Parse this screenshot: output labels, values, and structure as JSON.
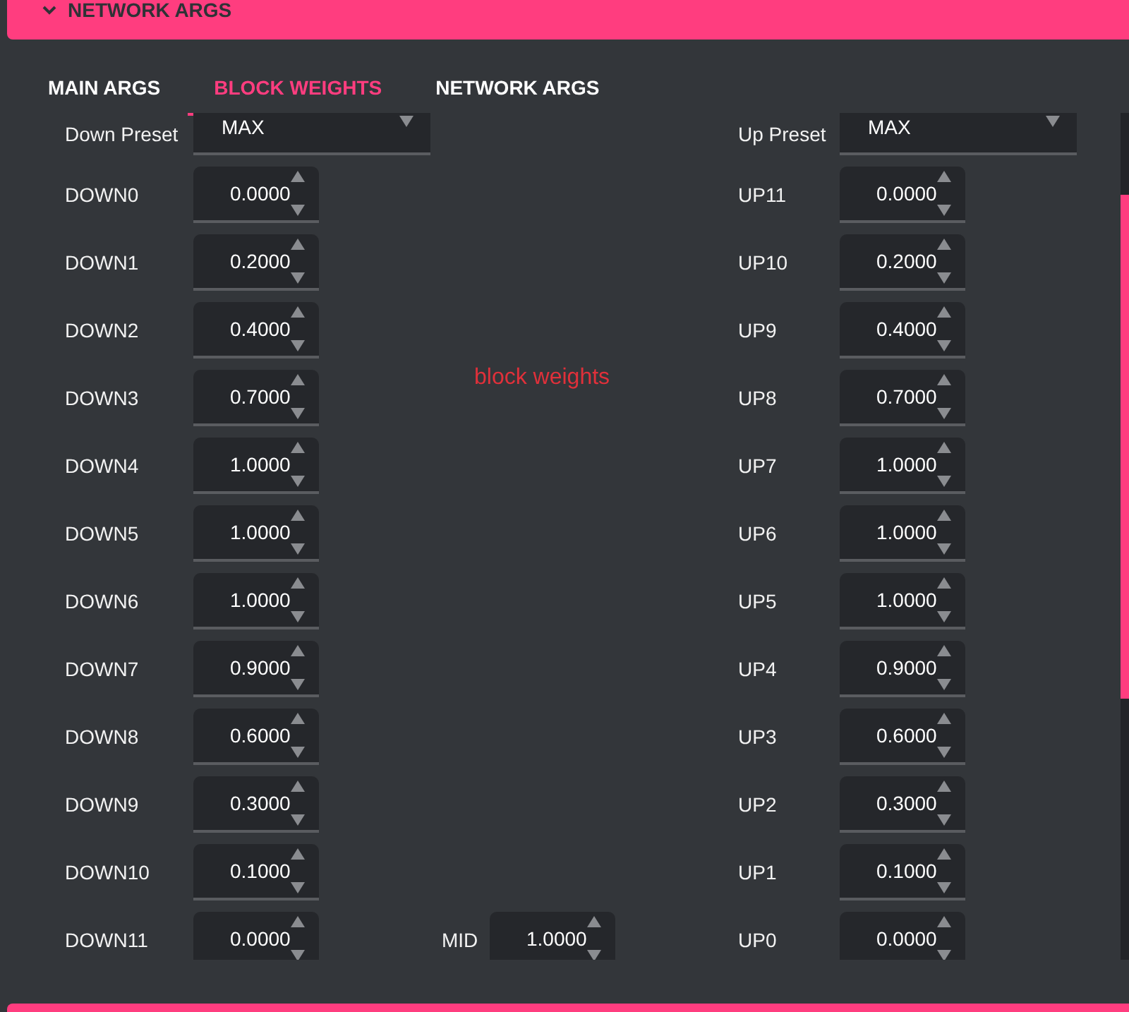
{
  "section": {
    "title": "NETWORK ARGS",
    "expanded": true
  },
  "tabs": [
    {
      "label": "MAIN ARGS",
      "selected": false
    },
    {
      "label": "BLOCK WEIGHTS",
      "selected": true
    },
    {
      "label": "NETWORK ARGS",
      "selected": false
    }
  ],
  "down_preset": {
    "label": "Down Preset",
    "value": "MAX"
  },
  "up_preset": {
    "label": "Up Preset",
    "value": "MAX"
  },
  "annotation": "block weights",
  "down": [
    {
      "label": "DOWN0",
      "value": "0.0000"
    },
    {
      "label": "DOWN1",
      "value": "0.2000"
    },
    {
      "label": "DOWN2",
      "value": "0.4000"
    },
    {
      "label": "DOWN3",
      "value": "0.7000"
    },
    {
      "label": "DOWN4",
      "value": "1.0000"
    },
    {
      "label": "DOWN5",
      "value": "1.0000"
    },
    {
      "label": "DOWN6",
      "value": "1.0000"
    },
    {
      "label": "DOWN7",
      "value": "0.9000"
    },
    {
      "label": "DOWN8",
      "value": "0.6000"
    },
    {
      "label": "DOWN9",
      "value": "0.3000"
    },
    {
      "label": "DOWN10",
      "value": "0.1000"
    },
    {
      "label": "DOWN11",
      "value": "0.0000"
    }
  ],
  "mid": {
    "label": "MID",
    "value": "1.0000"
  },
  "up": [
    {
      "label": "UP11",
      "value": "0.0000"
    },
    {
      "label": "UP10",
      "value": "0.2000"
    },
    {
      "label": "UP9",
      "value": "0.4000"
    },
    {
      "label": "UP8",
      "value": "0.7000"
    },
    {
      "label": "UP7",
      "value": "1.0000"
    },
    {
      "label": "UP6",
      "value": "1.0000"
    },
    {
      "label": "UP5",
      "value": "1.0000"
    },
    {
      "label": "UP4",
      "value": "0.9000"
    },
    {
      "label": "UP3",
      "value": "0.6000"
    },
    {
      "label": "UP2",
      "value": "0.3000"
    },
    {
      "label": "UP1",
      "value": "0.1000"
    },
    {
      "label": "UP0",
      "value": "0.0000"
    }
  ]
}
